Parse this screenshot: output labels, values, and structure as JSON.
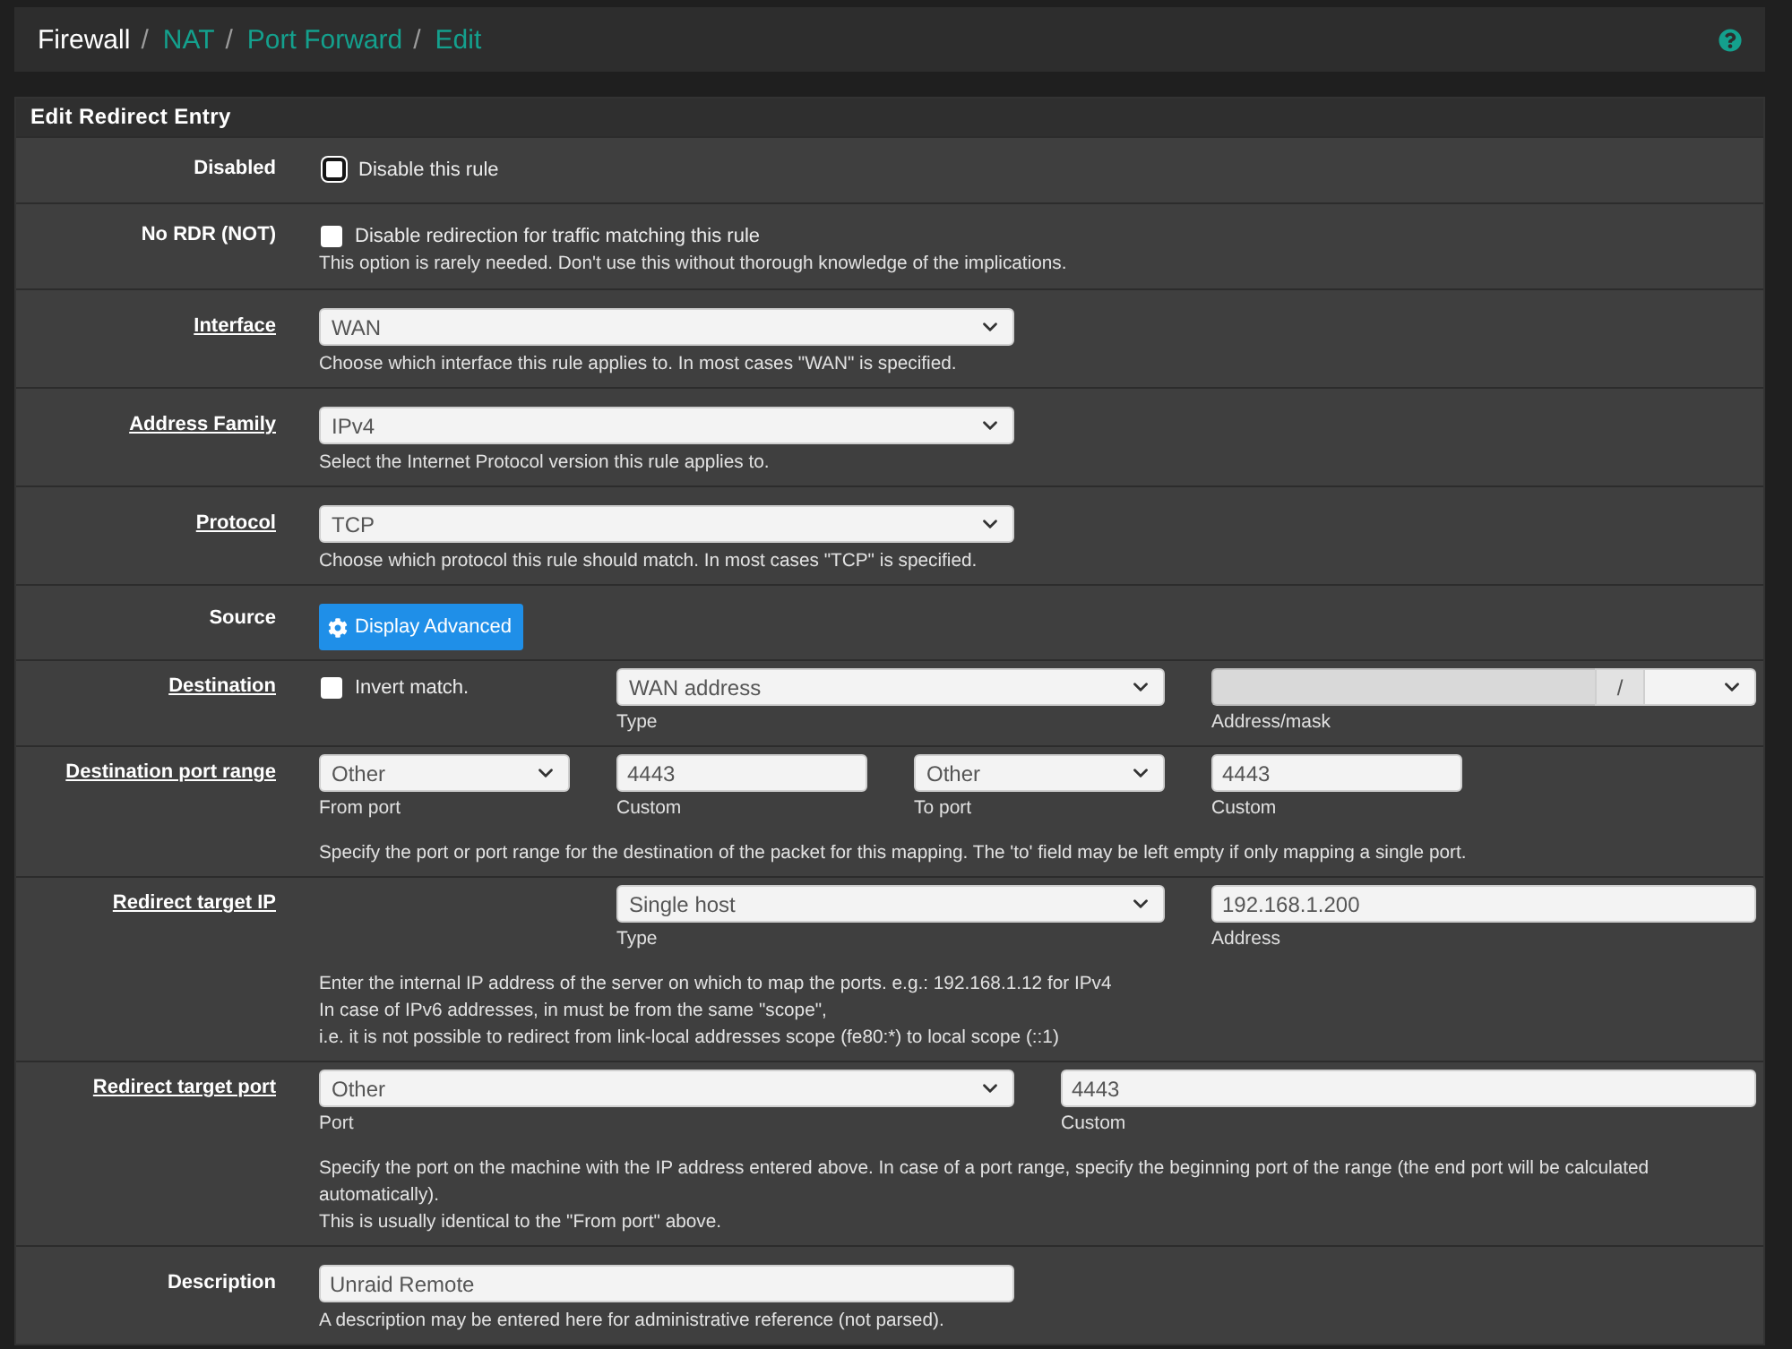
{
  "breadcrumb": {
    "items": [
      {
        "label": "Firewall",
        "link": false,
        "separator": "/"
      },
      {
        "label": "NAT",
        "link": true,
        "separator": "/"
      },
      {
        "label": "Port Forward",
        "link": true,
        "separator": "/"
      },
      {
        "label": "Edit",
        "link": true
      }
    ]
  },
  "panel": {
    "title": "Edit Redirect Entry",
    "rows": [
      {
        "kind": "checkbox",
        "label": "Disabled",
        "label_link": false,
        "fields": [
          {
            "kind": "checkbox",
            "label": "Disable this rule",
            "checked": false,
            "focused": true
          }
        ]
      },
      {
        "kind": "checkbox",
        "label": "No RDR (NOT)",
        "label_link": false,
        "fields": [
          {
            "kind": "checkbox",
            "label": "Disable redirection for traffic matching this rule",
            "checked": false,
            "focused": false
          }
        ],
        "help": [
          "This option is rarely needed. Don't use this without thorough knowledge of the implications."
        ]
      },
      {
        "kind": "single",
        "label": "Interface",
        "label_link": true,
        "fields": [
          {
            "kind": "select",
            "value": "WAN"
          }
        ],
        "help": [
          "Choose which interface this rule applies to. In most cases \"WAN\" is specified."
        ]
      },
      {
        "kind": "single",
        "label": "Address Family",
        "label_link": true,
        "fields": [
          {
            "kind": "select",
            "value": "IPv4"
          }
        ],
        "help": [
          "Select the Internet Protocol version this rule applies to."
        ]
      },
      {
        "kind": "single",
        "label": "Protocol",
        "label_link": true,
        "fields": [
          {
            "kind": "select",
            "value": "TCP"
          }
        ],
        "help": [
          "Choose which protocol this rule should match. In most cases \"TCP\" is specified."
        ]
      },
      {
        "kind": "single",
        "label": "Source",
        "label_link": false,
        "fields": [
          {
            "kind": "button",
            "label": "Display Advanced"
          }
        ]
      },
      {
        "kind": "destination",
        "label": "Destination",
        "label_link": true,
        "fields": [
          {
            "kind": "checkbox",
            "label": "Invert match.",
            "checked": false,
            "focused": false
          },
          {
            "kind": "select",
            "value": "WAN address",
            "caption": "Type"
          },
          {
            "kind": "address_mask",
            "separator": "/",
            "disabled": true,
            "caption": "Address/mask"
          }
        ]
      },
      {
        "kind": "quad",
        "label": "Destination port range",
        "label_link": true,
        "fields": [
          {
            "kind": "select",
            "value": "Other",
            "caption": "From port"
          },
          {
            "kind": "input",
            "value": "4443",
            "caption": "Custom"
          },
          {
            "kind": "select",
            "value": "Other",
            "caption": "To port"
          },
          {
            "kind": "input",
            "value": "4443",
            "caption": "Custom"
          }
        ],
        "help": [
          "Specify the port or port range for the destination of the packet for this mapping. The 'to' field may be left empty if only mapping a single port."
        ]
      },
      {
        "kind": "target_ip",
        "label": "Redirect target IP",
        "label_link": true,
        "fields": [
          {
            "kind": "select",
            "value": "Single host",
            "caption": "Type"
          },
          {
            "kind": "input",
            "value": "192.168.1.200",
            "caption": "Address"
          }
        ],
        "help": [
          "Enter the internal IP address of the server on which to map the ports. e.g.: 192.168.1.12 for IPv4",
          "In case of IPv6 addresses, in must be from the same \"scope\",",
          "i.e. it is not possible to redirect from link-local addresses scope (fe80:*) to local scope (::1)"
        ]
      },
      {
        "kind": "pair",
        "label": "Redirect target port",
        "label_link": true,
        "fields": [
          {
            "kind": "select",
            "value": "Other",
            "caption": "Port"
          },
          {
            "kind": "input",
            "value": "4443",
            "caption": "Custom"
          }
        ],
        "help": [
          "Specify the port on the machine with the IP address entered above. In case of a port range, specify the beginning port of the range (the end port will be calculated automatically).",
          "This is usually identical to the \"From port\" above."
        ]
      },
      {
        "kind": "single",
        "label": "Description",
        "label_link": false,
        "fields": [
          {
            "kind": "input",
            "value": "Unraid Remote"
          }
        ],
        "help": [
          "A description may be entered here for administrative reference (not parsed)."
        ]
      }
    ]
  }
}
